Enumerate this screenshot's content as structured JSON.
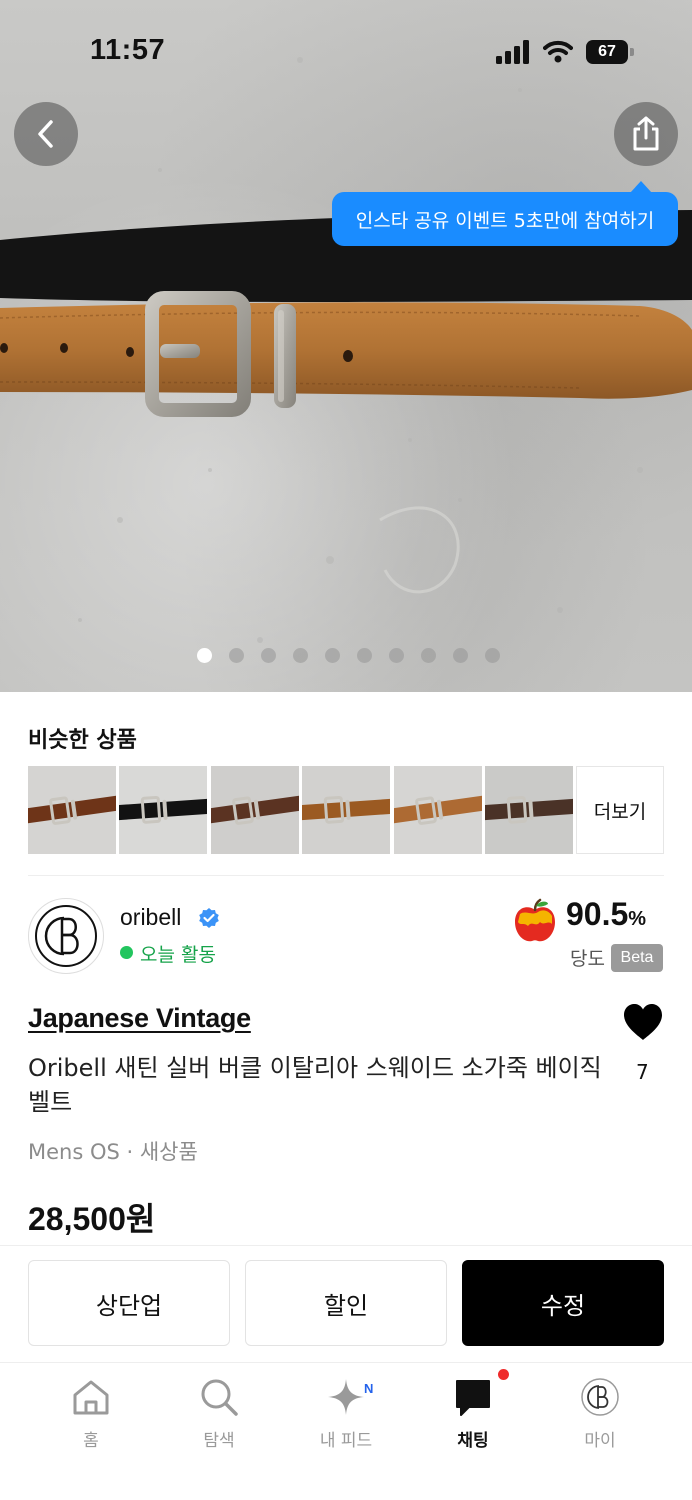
{
  "status_bar": {
    "time": "11:57",
    "battery": "67"
  },
  "hero": {
    "tooltip": "인스타 공유 이벤트 5초만에 참여하기",
    "image_count": 10,
    "active_index": 0
  },
  "similar": {
    "title": "비슷한 상품",
    "more_label": "더보기",
    "thumbs": [
      {
        "strap": "#6e3418",
        "bg": "#d5d4d2"
      },
      {
        "strap": "#121212",
        "bg": "#d9d9d7"
      },
      {
        "strap": "#5b3322",
        "bg": "#cfcecc"
      },
      {
        "strap": "#9b5a22",
        "bg": "#d2d1cf"
      },
      {
        "strap": "#ad6a33",
        "bg": "#d6d5d3"
      },
      {
        "strap": "#4a3227",
        "bg": "#cacac8"
      }
    ]
  },
  "seller": {
    "name": "oribell",
    "verified": true,
    "online_text": "오늘 활동",
    "avatar_icon": "oribell-monogram-icon",
    "score": "90.5",
    "score_unit": "%",
    "score_label": "당도",
    "beta_label": "Beta"
  },
  "product": {
    "brand": "Japanese Vintage",
    "title": "Oribell 새틴 실버 버클 이탈리아 스웨이드 소가죽 베이직 벨트",
    "meta": "Mens OS · 새상품",
    "price": "28,500원",
    "likes": "7"
  },
  "actions": {
    "bump": "상단업",
    "discount": "할인",
    "edit": "수정"
  },
  "tabbar": {
    "items": [
      {
        "label": "홈",
        "icon": "home-icon"
      },
      {
        "label": "탐색",
        "icon": "search-icon"
      },
      {
        "label": "내 피드",
        "icon": "sparkle-icon",
        "badge": "N"
      },
      {
        "label": "채팅",
        "icon": "chat-icon",
        "active": true
      },
      {
        "label": "마이",
        "icon": "profile-icon"
      }
    ]
  },
  "colors": {
    "accent_blue": "#1a8cff",
    "online_green": "#22c55e",
    "suede": "#b07234"
  }
}
